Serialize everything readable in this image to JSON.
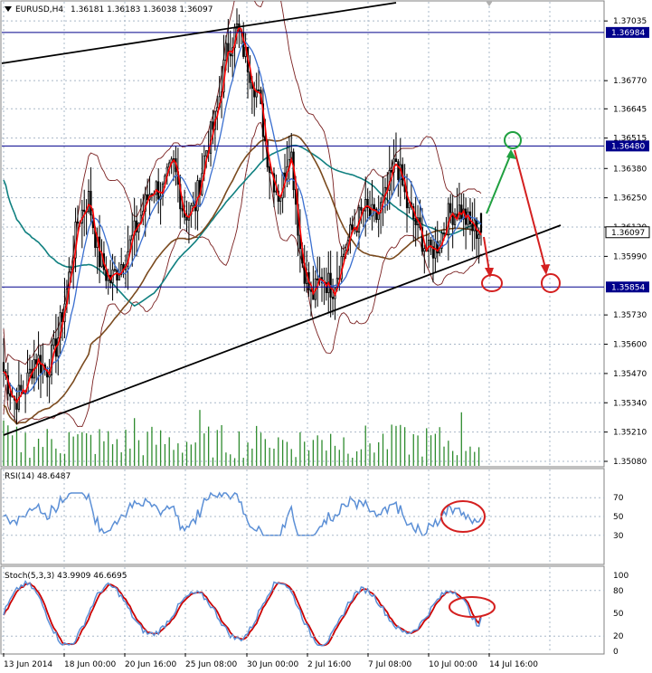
{
  "header": {
    "symbol_label": "EURUSD,H4",
    "ohlc": "1.36181 1.36183 1.36038 1.36097"
  },
  "indicators": {
    "rsi_label": "RSI(14) 48.6487",
    "stoch_label": "Stoch(5,3,3) 43.9909 46.6695"
  },
  "price_axis": {
    "ticks": [
      "1.37035",
      "1.36770",
      "1.36645",
      "1.36515",
      "1.36380",
      "1.36250",
      "1.36120",
      "1.35990",
      "1.35730",
      "1.35600",
      "1.35470",
      "1.35340",
      "1.35210",
      "1.35080"
    ],
    "hlines": [
      {
        "label": "1.36984",
        "color": "#00008b"
      },
      {
        "label": "1.36480",
        "color": "#00008b"
      },
      {
        "label": "1.35854",
        "color": "#00008b"
      }
    ],
    "current_price": "1.36097"
  },
  "rsi_axis": {
    "ticks": [
      "70",
      "50",
      "30"
    ]
  },
  "stoch_axis": {
    "ticks": [
      "100",
      "80",
      "50",
      "20",
      "0"
    ]
  },
  "time_axis": {
    "ticks": [
      "13 Jun 2014",
      "18 Jun 00:00",
      "20 Jun 16:00",
      "25 Jun 08:00",
      "30 Jun 00:00",
      "2 Jul 16:00",
      "7 Jul 08:00",
      "10 Jul 00:00",
      "14 Jul 16:00"
    ]
  },
  "chart_data": [
    {
      "type": "candlestick",
      "name": "EURUSD,H4",
      "x_labels": [
        "13 Jun 2014",
        "18 Jun 00:00",
        "20 Jun 16:00",
        "25 Jun 08:00",
        "30 Jun 00:00",
        "2 Jul 16:00",
        "7 Jul 08:00",
        "10 Jul 00:00",
        "14 Jul 16:00"
      ],
      "close_path": [
        1.3548,
        1.3535,
        1.354,
        1.3555,
        1.3548,
        1.356,
        1.3585,
        1.3615,
        1.3625,
        1.3598,
        1.3588,
        1.3595,
        1.3605,
        1.3618,
        1.363,
        1.3628,
        1.364,
        1.3618,
        1.362,
        1.3645,
        1.366,
        1.369,
        1.37,
        1.3685,
        1.367,
        1.364,
        1.3625,
        1.365,
        1.36,
        1.358,
        1.359,
        1.3585,
        1.36,
        1.3612,
        1.362,
        1.3615,
        1.3625,
        1.3642,
        1.3622,
        1.3612,
        1.36,
        1.3605,
        1.3618,
        1.362,
        1.3612,
        1.361
      ],
      "last_ohlc": {
        "open": 1.36181,
        "high": 1.36183,
        "low": 1.36038,
        "close": 1.36097
      },
      "horizontal_levels": [
        1.36984,
        1.3648,
        1.35854
      ],
      "ylim": [
        1.3506,
        1.3712
      ]
    },
    {
      "type": "line",
      "name": "RSI(14)",
      "last_value": 48.6487,
      "levels": [
        70,
        50,
        30
      ],
      "ylim": [
        0,
        100
      ]
    },
    {
      "type": "line",
      "name": "Stoch(5,3,3)",
      "main_last": 43.9909,
      "signal_last": 46.6695,
      "levels": [
        100,
        80,
        50,
        20,
        0
      ],
      "ylim": [
        0,
        100
      ]
    }
  ],
  "colors": {
    "grid": "#a9b8c8",
    "candles": "#000000",
    "ma_fast": "#ff0000",
    "ma_blue": "#3a6fd0",
    "ma_teal": "#108080",
    "ma_brown": "#7a4a1e",
    "bands": "#7a2020",
    "volume": "#2e8b2e",
    "rsi": "#5b8fd6",
    "stoch_main": "#5b8fd6",
    "stoch_signal": "#cc0000",
    "annotation_red": "#d42020",
    "annotation_green": "#20a040"
  }
}
